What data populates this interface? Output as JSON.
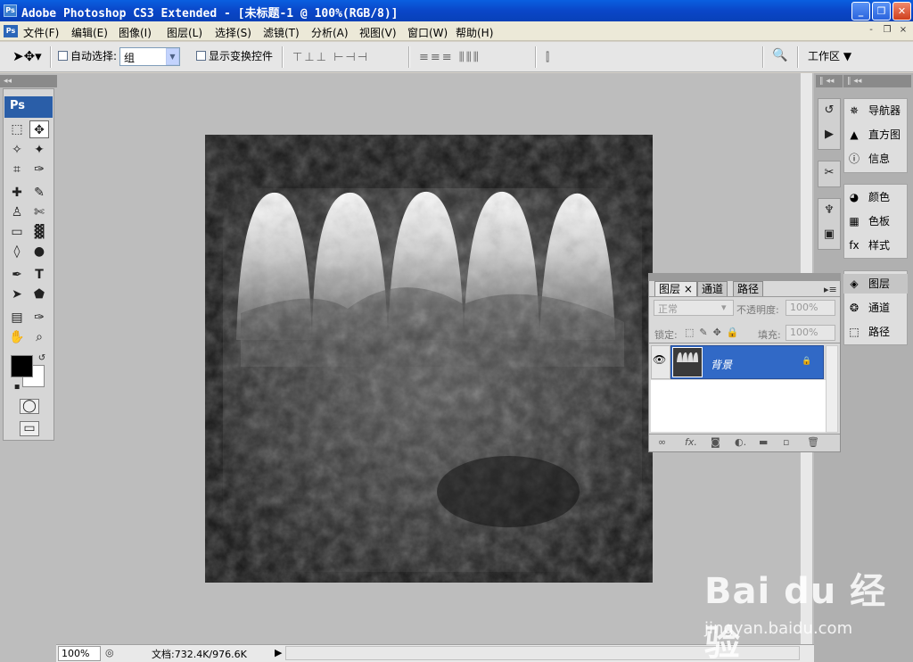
{
  "window": {
    "title": "Adobe Photoshop CS3 Extended - [未标题-1 @ 100%(RGB/8)]",
    "app_icon": "Ps",
    "minimize": "_",
    "restore": "❐",
    "close": "✕"
  },
  "menubar": {
    "items": [
      "文件(F)",
      "编辑(E)",
      "图像(I)",
      "图层(L)",
      "选择(S)",
      "滤镜(T)",
      "分析(A)",
      "视图(V)",
      "窗口(W)",
      "帮助(H)"
    ],
    "mdi_min": "-",
    "mdi_restore": "❐",
    "mdi_close": "×"
  },
  "options": {
    "auto_select_label": "自动选择:",
    "auto_select_value": "组",
    "show_transform_label": "显示变换控件",
    "workspace_label": "工作区 ▼"
  },
  "toolbox": {
    "logo": "Ps",
    "tools": [
      "⬚",
      "✥",
      "✧",
      "✦",
      "⌗",
      "✑",
      "✚",
      "✎",
      "♙",
      "✄",
      "▭",
      "▓",
      "◊",
      "●",
      "✒",
      "T",
      "➤",
      "⬟",
      "▤",
      "✑",
      "✋",
      "⌕"
    ]
  },
  "canvas": {
    "description_color": "#2a2a2a"
  },
  "right_panels": {
    "group1": [
      "导航器",
      "直方图",
      "信息"
    ],
    "group2": [
      "颜色",
      "色板",
      "样式"
    ],
    "group3": [
      "图层",
      "通道",
      "路径"
    ]
  },
  "layers_panel": {
    "tabs": [
      "图层",
      "通道",
      "路径"
    ],
    "blend_mode": "正常",
    "opacity_label": "不透明度:",
    "opacity_value": "100%",
    "lock_label": "锁定:",
    "fill_label": "填充:",
    "fill_value": "100%",
    "layer_name": "背景"
  },
  "status": {
    "zoom": "100%",
    "doc_info": "文档:732.4K/976.6K"
  },
  "watermark": {
    "main": "Bai du 经验",
    "sub": "jingyan.baidu.com"
  }
}
